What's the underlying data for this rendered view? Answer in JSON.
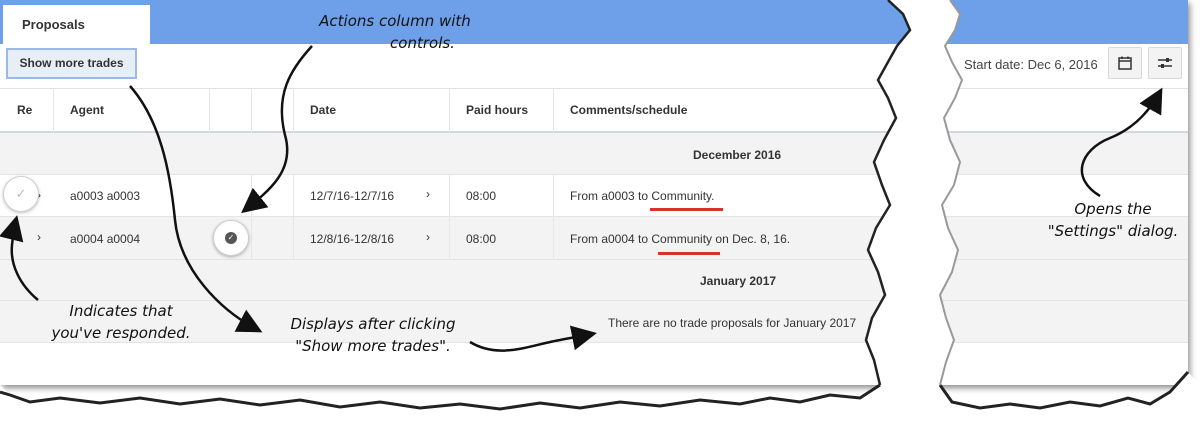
{
  "tabs": {
    "active": "Proposals"
  },
  "toolbar": {
    "show_more": "Show more trades",
    "start_date": "Start date: Dec 6, 2016",
    "calendar_icon": "calendar-icon",
    "settings_icon": "sliders-icon"
  },
  "columns": [
    "Re",
    "Agent",
    "Date",
    "Paid hours",
    "Comments/schedule"
  ],
  "groups": {
    "dec": "December 2016",
    "jan": "January 2017"
  },
  "rows": [
    {
      "agent": "a0003 a0003",
      "date": "12/7/16-12/7/16",
      "hours": "08:00",
      "comment_pre": "From a0003 to ",
      "comment_link": "Community",
      "comment_post": "."
    },
    {
      "agent": "a0004 a0004",
      "date": "12/8/16-12/8/16",
      "hours": "08:00",
      "comment_pre": "From a0004 to ",
      "comment_link": "Community",
      "comment_post": " on Dec. 8, 16."
    }
  ],
  "empty_january": "There are no trade proposals for January 2017",
  "annotations": {
    "actions_line1": "Actions column with",
    "actions_line2": "controls.",
    "settings_line1": "Opens the",
    "settings_line2": "\"Settings\" dialog.",
    "responded_line1": "Indicates that",
    "responded_line2": "you've responded.",
    "displays_line1": "Displays after clicking",
    "displays_line2": "\"Show more trades\"."
  },
  "colors": {
    "header_band": "#6ea0ea",
    "group_bg": "#f3f3f3",
    "underline": "#d9312b"
  }
}
